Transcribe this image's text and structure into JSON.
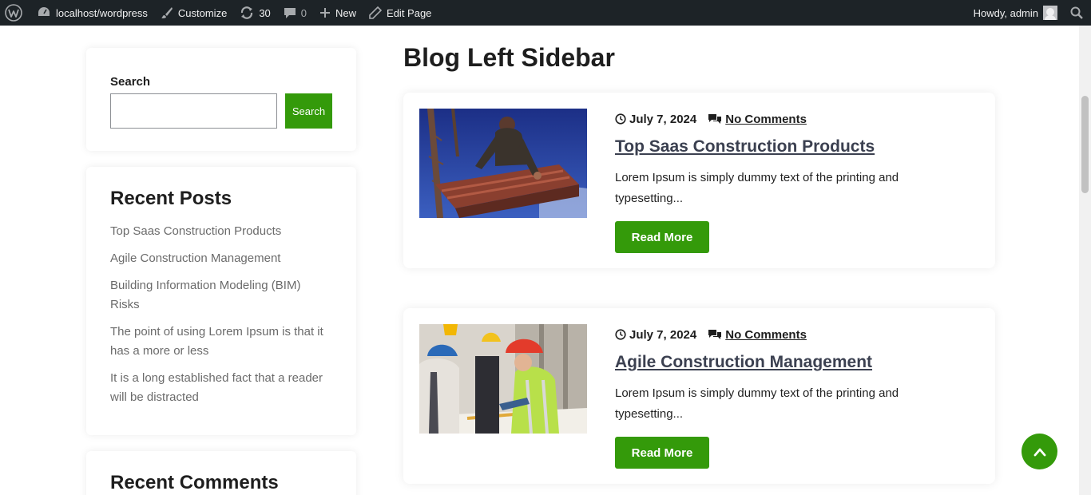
{
  "adminbar": {
    "site": "localhost/wordpress",
    "customize": "Customize",
    "updates": "30",
    "comments": "0",
    "new": "New",
    "edit": "Edit Page",
    "howdy": "Howdy, admin"
  },
  "sidebar": {
    "search_label": "Search",
    "search_value": "",
    "search_button": "Search",
    "recent_title": "Recent Posts",
    "recent_posts": [
      "Top Saas Construction Products",
      "Agile Construction Management",
      "Building Information Modeling (BIM) Risks",
      "The point of using Lorem Ipsum is that it has a more or less",
      "It is a long established fact that a reader will be distracted"
    ],
    "comments_title": "Recent Comments"
  },
  "main": {
    "title": "Blog Left Sidebar",
    "posts": [
      {
        "date": "July 7, 2024",
        "comments": "No Comments",
        "title": "Top Saas Construction Products",
        "excerpt": "Lorem Ipsum is simply dummy text of the printing and typesetting...",
        "button": "Read More"
      },
      {
        "date": "July 7, 2024",
        "comments": "No Comments",
        "title": "Agile Construction Management",
        "excerpt": "Lorem Ipsum is simply dummy text of the printing and typesetting...",
        "button": "Read More"
      }
    ]
  },
  "colors": {
    "accent": "#349a0a",
    "adminbar": "#1d2327"
  }
}
